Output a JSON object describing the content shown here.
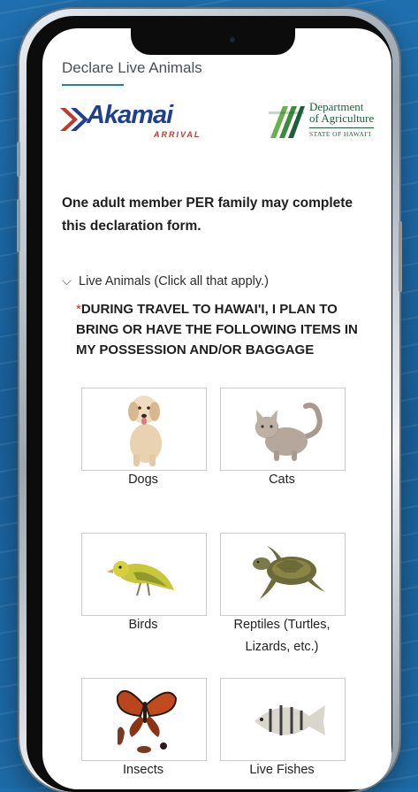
{
  "form": {
    "title": "Declare Live Animals",
    "akamai_logo": {
      "word": "Akamai",
      "sub": "ARRIVAL"
    },
    "doa_logo": {
      "line1": "Department",
      "line2": "of Agriculture",
      "line3": "STATE OF HAWAI'I"
    },
    "intro": "One adult member PER family may complete this declaration form.",
    "section_label": "Live Animals (Click all that apply.)",
    "required_marker": "*",
    "question": "DURING TRAVEL TO HAWAI'I, I PLAN TO BRING OR HAVE THE FOLLOWING ITEMS IN MY POSSESSION AND/OR BAGGAGE"
  },
  "options": [
    {
      "label": "Dogs",
      "icon": "dog-icon"
    },
    {
      "label": "Cats",
      "icon": "cat-icon"
    },
    {
      "label": "Birds",
      "icon": "bird-icon"
    },
    {
      "label": "Reptiles (Turtles, Lizards, etc.)",
      "icon": "turtle-icon"
    },
    {
      "label": "Insects",
      "icon": "butterfly-icon"
    },
    {
      "label": "Live Fishes",
      "icon": "fish-icon"
    }
  ],
  "colors": {
    "accent": "#2b7ab8",
    "required": "#c0392b",
    "akamai_blue": "#1f3f8f",
    "doa_green": "#1f5e3a"
  }
}
